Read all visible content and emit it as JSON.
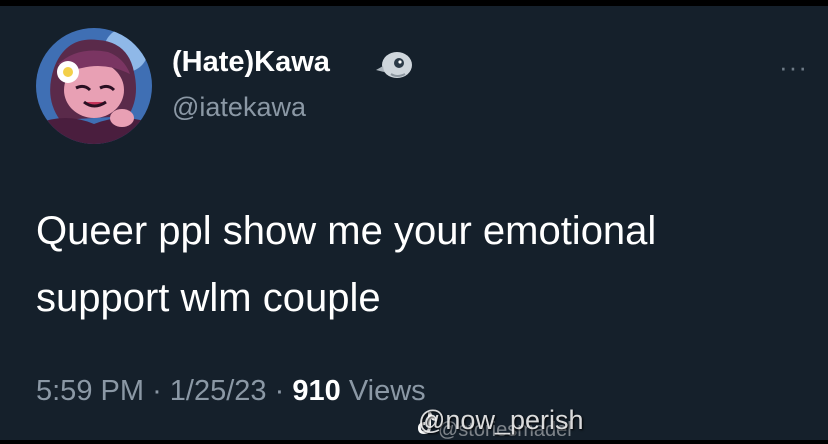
{
  "tweet": {
    "author": {
      "display_name": "(Hate)Kawa",
      "handle": "@iatekawa",
      "badge_icon": "bird-skull-icon",
      "avatar_icon": "cartoon-avatar-icon"
    },
    "more_label": "···",
    "text": "Queer ppl show me your emotional support wlm couple",
    "meta": {
      "time": "5:59 PM",
      "separator": "·",
      "date": "1/25/23",
      "views_count": "910",
      "views_label": "Views"
    }
  },
  "overlay": {
    "watermark": "@now_perish",
    "watermark_ghost": "@storiesmadel",
    "watermark_icon": "tiktok-icon"
  },
  "colors": {
    "background": "#15202b",
    "text_primary": "#ffffff",
    "text_secondary": "#8b98a5"
  }
}
